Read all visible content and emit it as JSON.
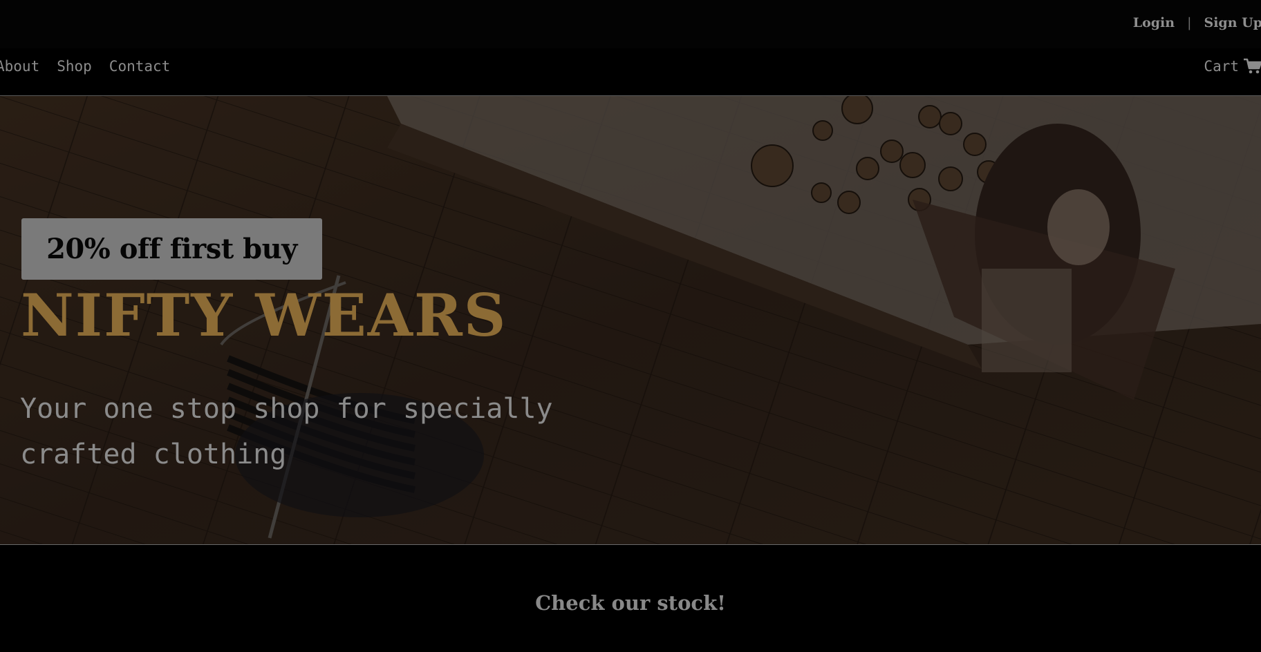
{
  "header": {
    "login_label": "Login",
    "separator": "|",
    "signup_label": "Sign Up"
  },
  "nav": {
    "links": [
      "About",
      "Shop",
      "Contact"
    ],
    "cart_label": "Cart",
    "cart_icon": "shopping-cart-icon"
  },
  "hero": {
    "promo_text": "20% off first buy",
    "brand_title": "NIFTY WEARS",
    "tagline": "Your one stop shop for specially crafted clothing",
    "background": "store floor photo"
  },
  "section": {
    "heading": "Check our stock!"
  },
  "colors": {
    "page_bg": "#000000",
    "brand_gold": "#8c6b35",
    "promo_bg": "#7a7a7a",
    "text_grey": "#8c8c8c"
  }
}
